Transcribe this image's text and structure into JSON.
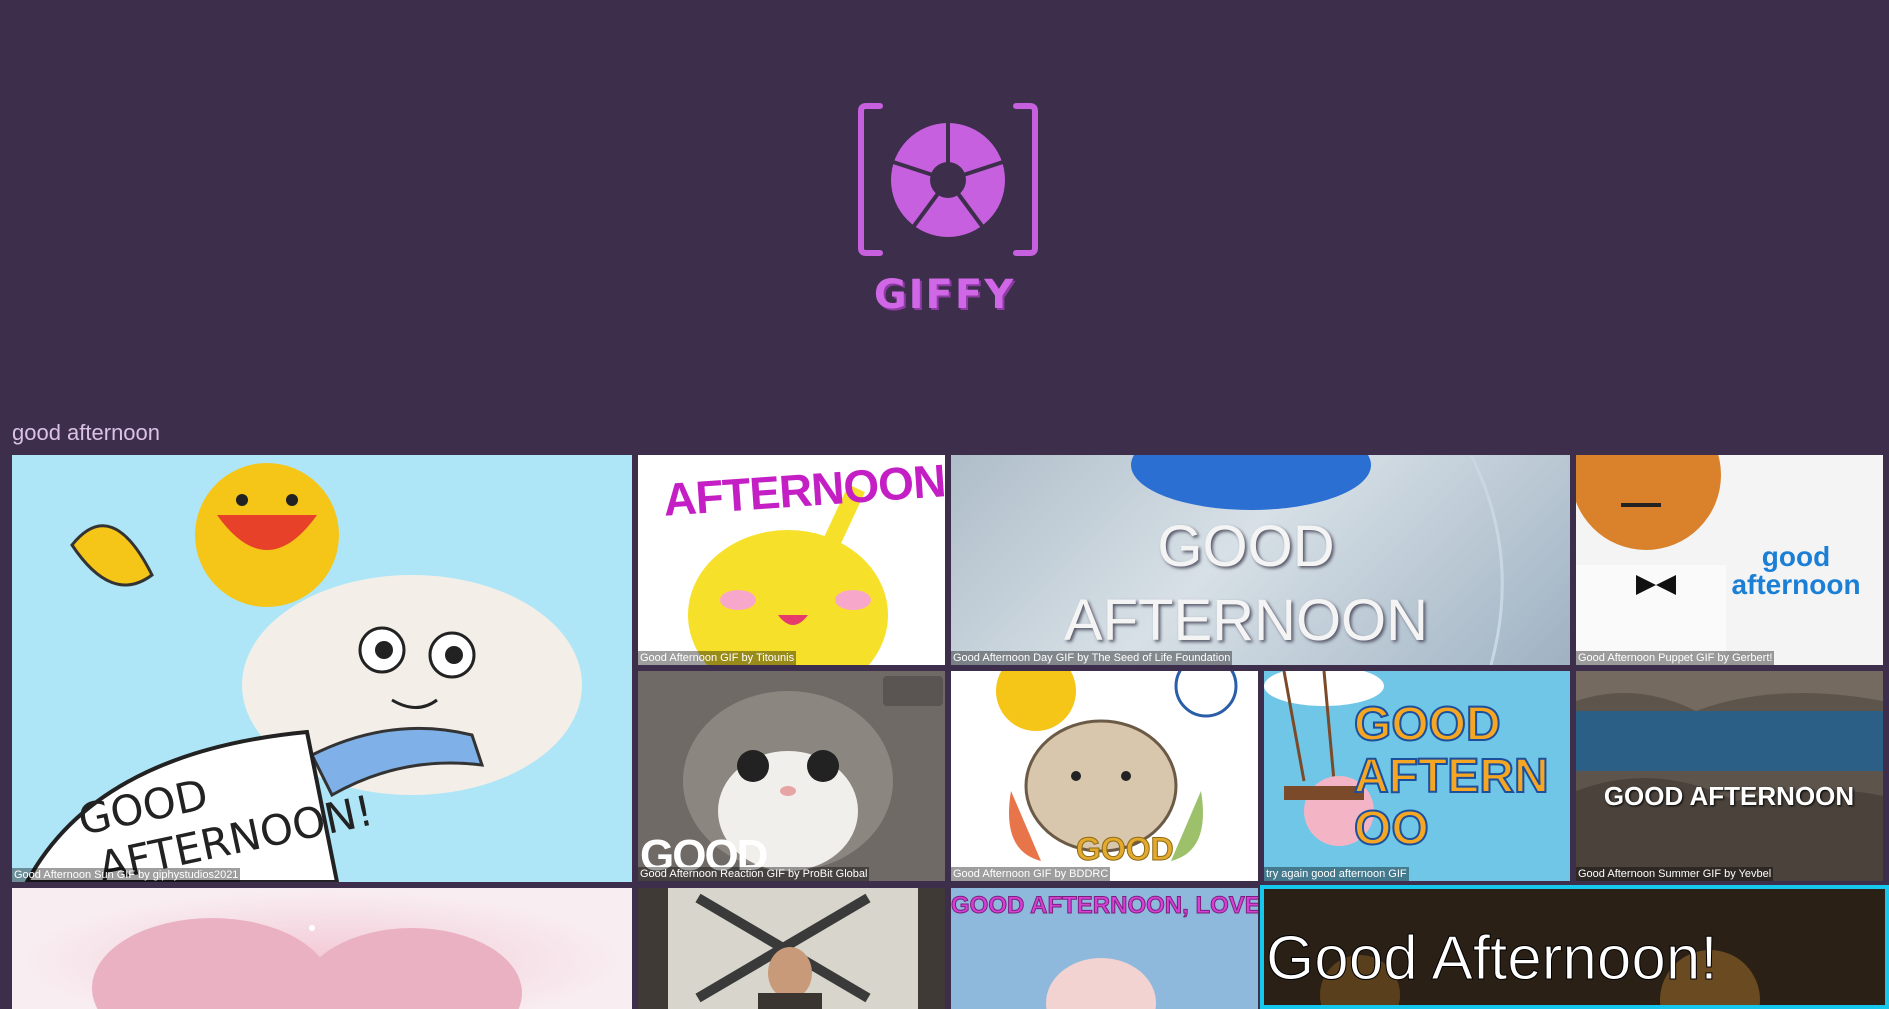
{
  "app": {
    "brand": "GIFFY"
  },
  "search": {
    "query": "good afternoon"
  },
  "results": [
    {
      "caption": "Good Afternoon Sun GIF by giphystudios2021",
      "overlay": "GOOD AFTERNOON!"
    },
    {
      "caption": "Good Afternoon GIF by Titounis",
      "overlay": "AFTERNOON"
    },
    {
      "caption": "Good Afternoon Day GIF by The Seed of Life Foundation",
      "overlay": "GOOD AFTERNOON"
    },
    {
      "caption": "Good Afternoon Puppet GIF by Gerbert!",
      "overlay": "good afternoon"
    },
    {
      "caption": "Good Afternoon Reaction GIF by ProBit Global",
      "overlay": "GOOD AFTERNOON"
    },
    {
      "caption": "Good Afternoon GIF by BDDRC",
      "overlay": "GOOD"
    },
    {
      "caption": "try again good afternoon GIF",
      "overlay": "GOOD AFTERNOO"
    },
    {
      "caption": "Good Afternoon Summer GIF by Yevbel",
      "overlay": "GOOD AFTERNOON"
    },
    {
      "caption": "",
      "overlay": ""
    },
    {
      "caption": "",
      "overlay": ""
    },
    {
      "caption": "",
      "overlay": "GOOD AFTERNOON, LOVE"
    },
    {
      "caption": "",
      "overlay": "Good Afternoon!"
    }
  ],
  "colors": {
    "background": "#3d2e4b",
    "accent": "#cf67e6",
    "focus": "#16c8ee",
    "query_text": "#dcc1e6"
  }
}
